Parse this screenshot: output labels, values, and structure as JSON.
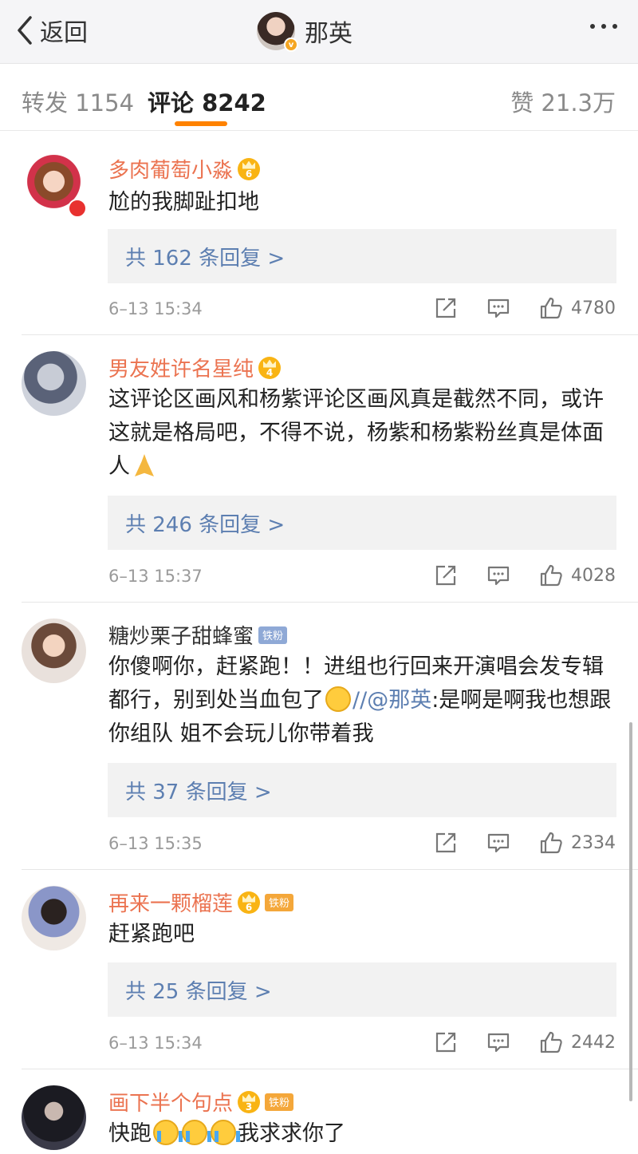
{
  "nav": {
    "back_label": "返回",
    "title": "那英",
    "verified": "v"
  },
  "tabs": {
    "repost": "转发 1154",
    "comments": "评论 8242",
    "likes": "赞 21.3万"
  },
  "comments": [
    {
      "name": "多肉葡萄小淼",
      "level": "6",
      "text": "尬的我脚趾扣地",
      "replies": "共 162 条回复 >",
      "time": "6–13 15:34",
      "likes": "4780"
    },
    {
      "name": "男友姓许名星纯",
      "level": "4",
      "text": "这评论区画风和杨紫评论区画风真是截然不同，或许这就是格局吧，不得不说，杨紫和杨紫粉丝真是体面人",
      "replies": "共 246 条回复 >",
      "time": "6–13 15:37",
      "likes": "4028"
    },
    {
      "name": "糖炒栗子甜蜂蜜",
      "badge": "铁粉",
      "text_before": "你傻啊你，赶紧跑！！进组也行回来开演唱会发专辑都行，别到处当血包了",
      "mention": "//@那英",
      "text_after": ":是啊是啊我也想跟你组队 姐不会玩儿你带着我",
      "replies": "共 37 条回复 >",
      "time": "6–13 15:35",
      "likes": "2334"
    },
    {
      "name": "再来一颗榴莲",
      "level": "6",
      "badge": "铁粉",
      "text": "赶紧跑吧",
      "replies": "共 25 条回复 >",
      "time": "6–13 15:34",
      "likes": "2442"
    },
    {
      "name": "画下半个句点",
      "level": "3",
      "badge": "铁粉",
      "text_before": "快跑",
      "text_after": "我求求你了"
    }
  ],
  "colors": {
    "accent": "#ff8200",
    "username": "#eb7350",
    "link": "#5d7fb1",
    "reply_bg": "#f2f2f2"
  },
  "icons": [
    "chevron-left-icon",
    "more-icon",
    "share-icon",
    "comment-icon",
    "like-icon",
    "crown-icon"
  ]
}
